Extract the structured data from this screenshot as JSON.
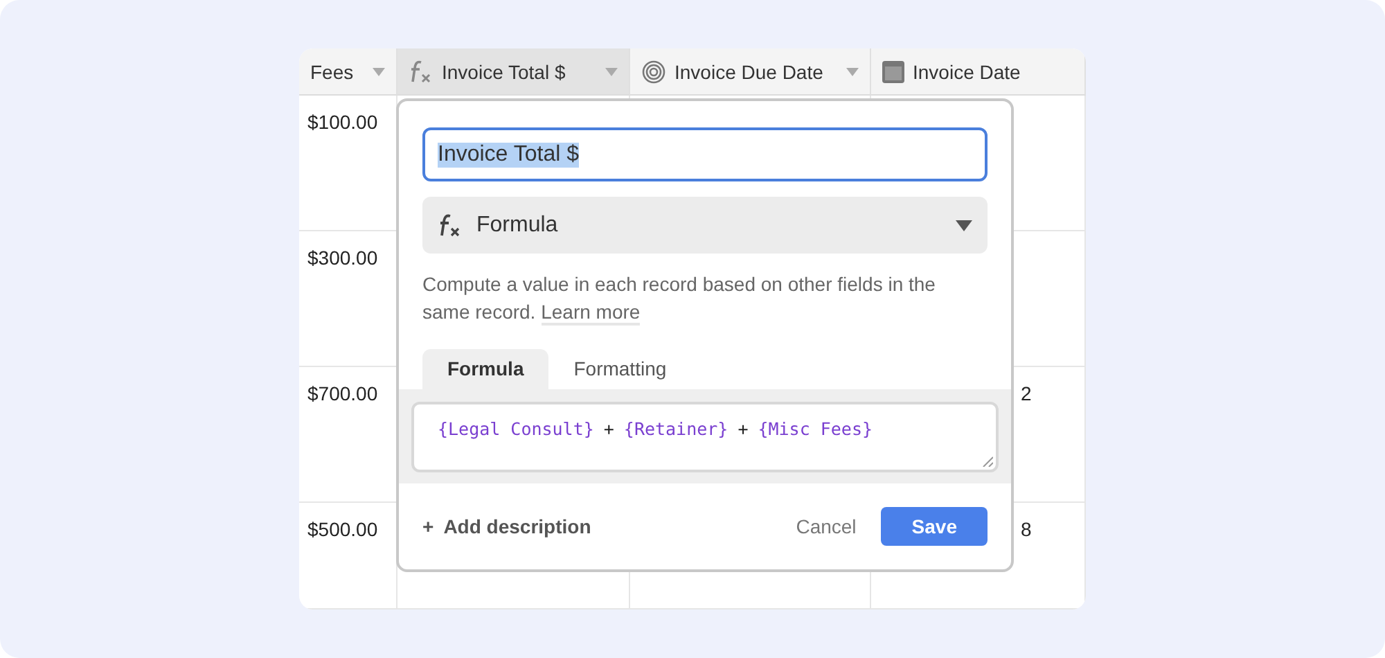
{
  "table": {
    "columns": [
      {
        "label": "Fees",
        "selected": false
      },
      {
        "label": "Invoice Total $",
        "selected": true
      },
      {
        "label": "Invoice Due Date",
        "selected": false
      },
      {
        "label": "Invoice Date",
        "selected": false
      }
    ],
    "rows": [
      [
        "$100.00",
        "",
        "",
        ""
      ],
      [
        "$300.00",
        "",
        "",
        ""
      ],
      [
        "$700.00",
        "",
        "",
        "2"
      ],
      [
        "$500.00",
        "",
        "",
        "8"
      ]
    ]
  },
  "popup": {
    "name_value": "Invoice Total $",
    "type": "Formula",
    "description": "Compute a value in each record based on other fields in the same record.",
    "learn_more": "Learn more",
    "tabs": [
      {
        "label": "Formula",
        "selected": true
      },
      {
        "label": "Formatting",
        "selected": false
      }
    ],
    "formula": [
      {
        "kind": "field",
        "text": "{Legal Consult}"
      },
      {
        "kind": "op",
        "text": "+"
      },
      {
        "kind": "field",
        "text": "{Retainer}"
      },
      {
        "kind": "op",
        "text": "+"
      },
      {
        "kind": "field",
        "text": "{Misc Fees}"
      }
    ],
    "add_description": "Add description",
    "add_icon": "+",
    "cancel": "Cancel",
    "save": "Save"
  }
}
